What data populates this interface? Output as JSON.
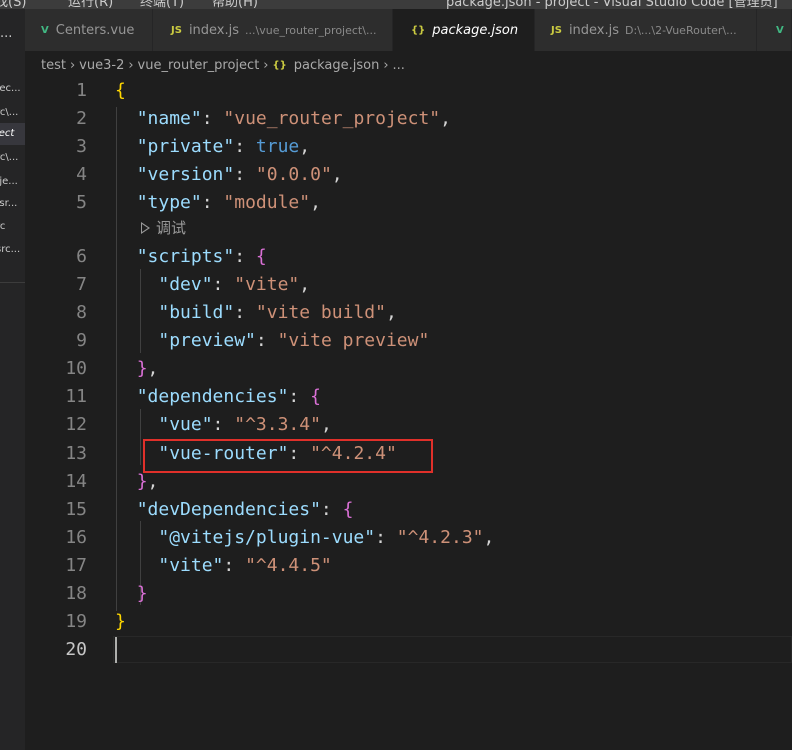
{
  "menu": [
    "寻找(S)",
    "运行(R)",
    "终端(T)",
    "帮助(H)"
  ],
  "window_title": "package.json - project - Visual Studio Code [管理员]",
  "sidebar": {
    "dots": "...",
    "items": [
      "\\ec...",
      "rc\\...",
      "ject",
      "rc\\...",
      "\\je...",
      "\\sr...",
      "rc",
      "src..."
    ]
  },
  "tabs": [
    {
      "icon": "V",
      "name": "Centers.vue",
      "desc": ""
    },
    {
      "icon": "JS",
      "name": "index.js",
      "desc": "...\\vue_router_project\\..."
    },
    {
      "icon": "{}",
      "name": "package.json",
      "desc": ""
    },
    {
      "icon": "JS",
      "name": "index.js",
      "desc": "D:\\...\\2-VueRouter\\..."
    },
    {
      "icon": "V",
      "name": "",
      "desc": ""
    }
  ],
  "breadcrumb": [
    "test",
    "vue3-2",
    "vue_router_project",
    "package.json",
    "..."
  ],
  "codelens": "调试",
  "line_numbers": [
    "1",
    "2",
    "3",
    "4",
    "5",
    "6",
    "7",
    "8",
    "9",
    "10",
    "11",
    "12",
    "13",
    "14",
    "15",
    "16",
    "17",
    "18",
    "19",
    "20"
  ],
  "code": {
    "name_key": "\"name\"",
    "name_val": "\"vue_router_project\"",
    "private_key": "\"private\"",
    "private_val": "true",
    "version_key": "\"version\"",
    "version_val": "\"0.0.0\"",
    "type_key": "\"type\"",
    "type_val": "\"module\"",
    "scripts_key": "\"scripts\"",
    "dev_key": "\"dev\"",
    "dev_val": "\"vite\"",
    "build_key": "\"build\"",
    "build_val": "\"vite build\"",
    "preview_key": "\"preview\"",
    "preview_val": "\"vite preview\"",
    "deps_key": "\"dependencies\"",
    "vue_key": "\"vue\"",
    "vue_val": "\"^3.3.4\"",
    "router_key": "\"vue-router\"",
    "router_val": "\"^4.2.4\"",
    "devdeps_key": "\"devDependencies\"",
    "plugin_key": "\"@vitejs/plugin-vue\"",
    "plugin_val": "\"^4.2.3\"",
    "vite_key": "\"vite\"",
    "vite_val": "\"^4.4.5\""
  },
  "colors": {
    "highlight_box": "#e0302a",
    "key": "#9cdcfe",
    "string": "#ce9178",
    "keyword": "#569cd6"
  }
}
